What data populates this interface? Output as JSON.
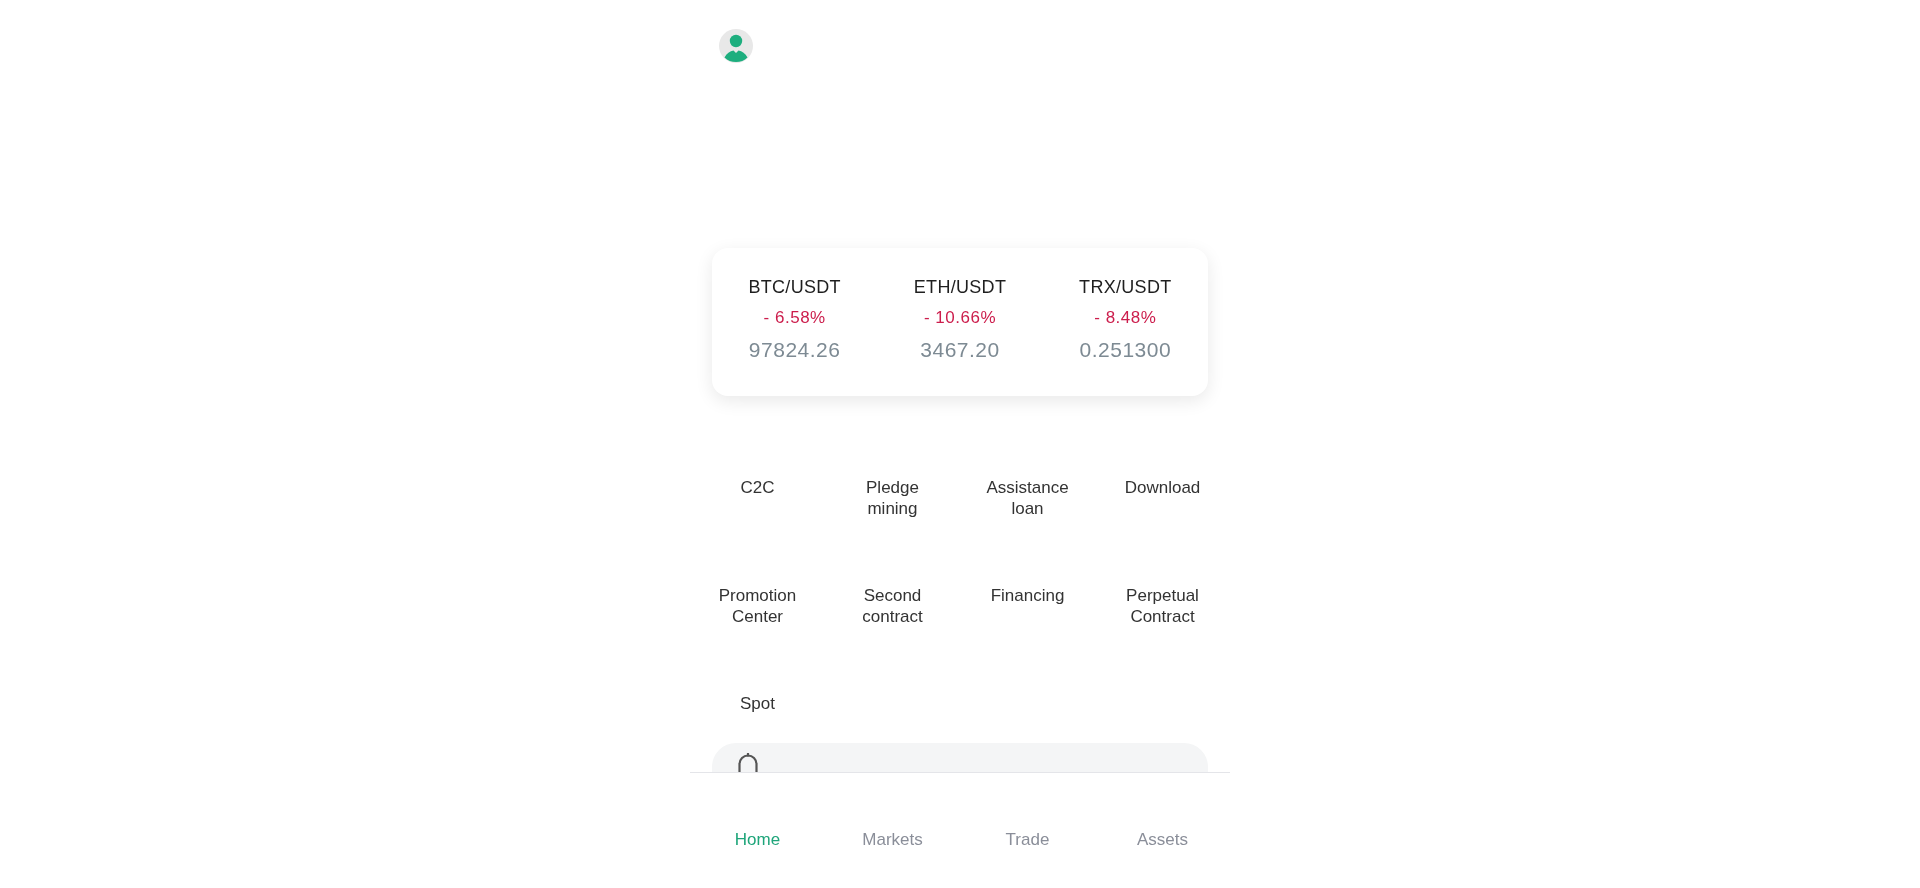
{
  "tickers": [
    {
      "pair": "BTC/USDT",
      "change": "- 6.58%",
      "falling": true,
      "price": "97824.26"
    },
    {
      "pair": "ETH/USDT",
      "change": "- 10.66%",
      "falling": true,
      "price": "3467.20"
    },
    {
      "pair": "TRX/USDT",
      "change": "- 8.48%",
      "falling": true,
      "price": "0.251300"
    }
  ],
  "menu": [
    "C2C",
    "Pledge mining",
    "Assistance loan",
    "Download",
    "Promotion Center",
    "Second contract",
    "Financing",
    "Perpetual Contract",
    "Spot"
  ],
  "bottom_nav": [
    {
      "label": "Home",
      "selected": true
    },
    {
      "label": "Markets",
      "selected": false
    },
    {
      "label": "Trade",
      "selected": false
    },
    {
      "label": "Assets",
      "selected": false
    }
  ]
}
